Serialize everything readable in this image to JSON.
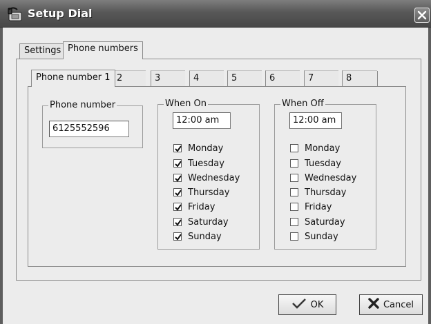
{
  "window": {
    "title": "Setup Dial",
    "close_glyph": "close-icon",
    "app_icon": "phone-icon"
  },
  "main_tabs": [
    {
      "label": "Settings",
      "active": false
    },
    {
      "label": "Phone numbers",
      "active": true
    }
  ],
  "phone_tabs": [
    {
      "label": "Phone number 1",
      "active": true
    },
    {
      "label": "2"
    },
    {
      "label": "3"
    },
    {
      "label": "4"
    },
    {
      "label": "5"
    },
    {
      "label": "6"
    },
    {
      "label": "7"
    },
    {
      "label": "8"
    }
  ],
  "phone_number": {
    "legend": "Phone number",
    "value": "6125552596"
  },
  "when_on": {
    "legend": "When On",
    "time": "12:00 am",
    "days": [
      {
        "label": "Monday",
        "checked": true
      },
      {
        "label": "Tuesday",
        "checked": true
      },
      {
        "label": "Wednesday",
        "checked": true
      },
      {
        "label": "Thursday",
        "checked": true
      },
      {
        "label": "Friday",
        "checked": true
      },
      {
        "label": "Saturday",
        "checked": true
      },
      {
        "label": "Sunday",
        "checked": true
      }
    ]
  },
  "when_off": {
    "legend": "When Off",
    "time": "12:00 am",
    "days": [
      {
        "label": "Monday",
        "checked": false
      },
      {
        "label": "Tuesday",
        "checked": false
      },
      {
        "label": "Wednesday",
        "checked": false
      },
      {
        "label": "Thursday",
        "checked": false
      },
      {
        "label": "Friday",
        "checked": false
      },
      {
        "label": "Saturday",
        "checked": false
      },
      {
        "label": "Sunday",
        "checked": false
      }
    ]
  },
  "buttons": {
    "ok": "OK",
    "cancel": "Cancel"
  }
}
